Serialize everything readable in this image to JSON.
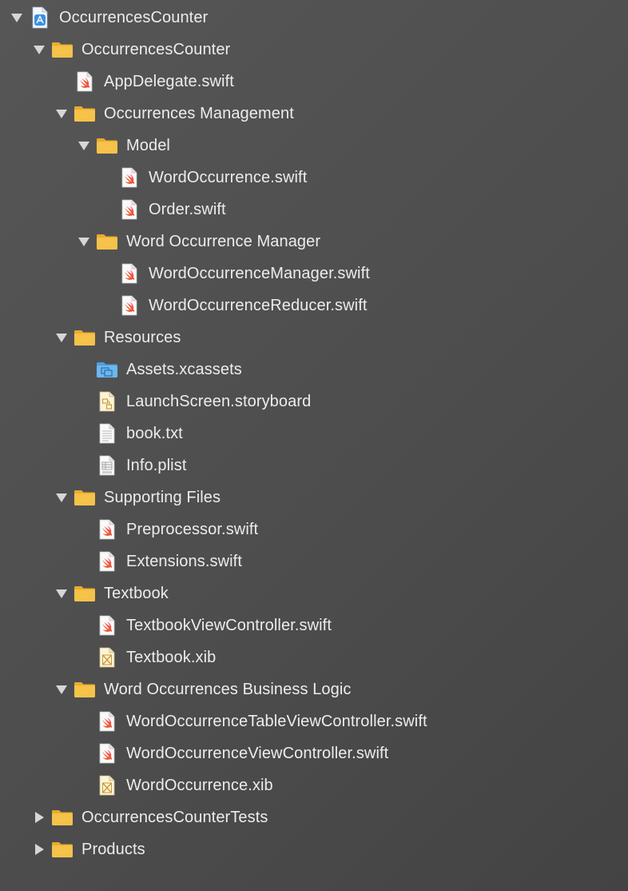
{
  "navigator": {
    "rows": [
      {
        "label": "OccurrencesCounter",
        "icon": "xcode-project-icon",
        "depth": 0,
        "disclosure": "expanded"
      },
      {
        "label": "OccurrencesCounter",
        "icon": "folder-icon",
        "depth": 1,
        "disclosure": "expanded"
      },
      {
        "label": "AppDelegate.swift",
        "icon": "swift-file-icon",
        "depth": 2,
        "disclosure": "none"
      },
      {
        "label": "Occurrences Management",
        "icon": "folder-icon",
        "depth": 2,
        "disclosure": "expanded"
      },
      {
        "label": "Model",
        "icon": "folder-icon",
        "depth": 3,
        "disclosure": "expanded"
      },
      {
        "label": "WordOccurrence.swift",
        "icon": "swift-file-icon",
        "depth": 4,
        "disclosure": "none"
      },
      {
        "label": "Order.swift",
        "icon": "swift-file-icon",
        "depth": 4,
        "disclosure": "none"
      },
      {
        "label": "Word Occurrence Manager",
        "icon": "folder-icon",
        "depth": 3,
        "disclosure": "expanded"
      },
      {
        "label": "WordOccurrenceManager.swift",
        "icon": "swift-file-icon",
        "depth": 4,
        "disclosure": "none"
      },
      {
        "label": "WordOccurrenceReducer.swift",
        "icon": "swift-file-icon",
        "depth": 4,
        "disclosure": "none"
      },
      {
        "label": "Resources",
        "icon": "folder-icon",
        "depth": 2,
        "disclosure": "expanded"
      },
      {
        "label": "Assets.xcassets",
        "icon": "asset-catalog-icon",
        "depth": 3,
        "disclosure": "none"
      },
      {
        "label": "LaunchScreen.storyboard",
        "icon": "storyboard-file-icon",
        "depth": 3,
        "disclosure": "none"
      },
      {
        "label": "book.txt",
        "icon": "text-file-icon",
        "depth": 3,
        "disclosure": "none"
      },
      {
        "label": "Info.plist",
        "icon": "plist-file-icon",
        "depth": 3,
        "disclosure": "none"
      },
      {
        "label": "Supporting Files",
        "icon": "folder-icon",
        "depth": 2,
        "disclosure": "expanded"
      },
      {
        "label": "Preprocessor.swift",
        "icon": "swift-file-icon",
        "depth": 3,
        "disclosure": "none"
      },
      {
        "label": "Extensions.swift",
        "icon": "swift-file-icon",
        "depth": 3,
        "disclosure": "none"
      },
      {
        "label": "Textbook",
        "icon": "folder-icon",
        "depth": 2,
        "disclosure": "expanded"
      },
      {
        "label": "TextbookViewController.swift",
        "icon": "swift-file-icon",
        "depth": 3,
        "disclosure": "none"
      },
      {
        "label": "Textbook.xib",
        "icon": "xib-file-icon",
        "depth": 3,
        "disclosure": "none"
      },
      {
        "label": "Word Occurrences Business Logic",
        "icon": "folder-icon",
        "depth": 2,
        "disclosure": "expanded"
      },
      {
        "label": "WordOccurrenceTableViewController.swift",
        "icon": "swift-file-icon",
        "depth": 3,
        "disclosure": "none"
      },
      {
        "label": "WordOccurrenceViewController.swift",
        "icon": "swift-file-icon",
        "depth": 3,
        "disclosure": "none"
      },
      {
        "label": "WordOccurrence.xib",
        "icon": "xib-file-icon",
        "depth": 3,
        "disclosure": "none"
      },
      {
        "label": "OccurrencesCounterTests",
        "icon": "folder-icon",
        "depth": 1,
        "disclosure": "collapsed"
      },
      {
        "label": "Products",
        "icon": "folder-icon",
        "depth": 1,
        "disclosure": "collapsed"
      }
    ]
  },
  "colors": {
    "folder": "#f5c24a",
    "folder_tab": "#e9ac2c",
    "swift": "#f05138",
    "asset_catalog": "#6bb8f0",
    "xcode_project": "#3d8fe0",
    "text": "#ececec",
    "disclosure": "#d6d6d6"
  }
}
